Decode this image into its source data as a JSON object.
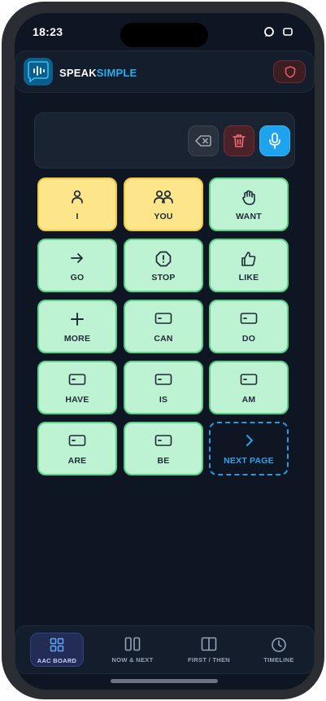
{
  "status_bar": {
    "time": "18:23"
  },
  "header": {
    "brand_part1": "SPEAK",
    "brand_part2": "SIMPLE",
    "colors": {
      "accent": "#26aef5",
      "danger": "#e05a63"
    }
  },
  "sentence_bar": {
    "text": "",
    "icons": [
      "backspace-icon",
      "trash-icon",
      "microphone-icon"
    ]
  },
  "tiles": [
    {
      "label": "I",
      "color": "yellow",
      "icon": "person-icon"
    },
    {
      "label": "YOU",
      "color": "yellow",
      "icon": "people-icon"
    },
    {
      "label": "WANT",
      "color": "green",
      "icon": "hand-icon"
    },
    {
      "label": "GO",
      "color": "green",
      "icon": "arrow-right-icon"
    },
    {
      "label": "STOP",
      "color": "green",
      "icon": "octagon-stop-icon"
    },
    {
      "label": "LIKE",
      "color": "green",
      "icon": "thumbs-up-icon"
    },
    {
      "label": "MORE",
      "color": "green",
      "icon": "plus-icon"
    },
    {
      "label": "CAN",
      "color": "green",
      "icon": "card-icon"
    },
    {
      "label": "DO",
      "color": "green",
      "icon": "card-icon"
    },
    {
      "label": "HAVE",
      "color": "green",
      "icon": "card-icon"
    },
    {
      "label": "IS",
      "color": "green",
      "icon": "card-icon"
    },
    {
      "label": "AM",
      "color": "green",
      "icon": "card-icon"
    },
    {
      "label": "ARE",
      "color": "green",
      "icon": "card-icon"
    },
    {
      "label": "BE",
      "color": "green",
      "icon": "card-icon"
    },
    {
      "label": "NEXT PAGE",
      "color": "next",
      "icon": "chevron-right-icon"
    }
  ],
  "bottom_nav": [
    {
      "label": "AAC BOARD",
      "active": true,
      "icon": "grid-icon"
    },
    {
      "label": "NOW & NEXT",
      "active": false,
      "icon": "two-columns-icon"
    },
    {
      "label": "FIRST / THEN",
      "active": false,
      "icon": "split-panel-icon"
    },
    {
      "label": "TIMELINE",
      "active": false,
      "icon": "clock-icon"
    }
  ]
}
